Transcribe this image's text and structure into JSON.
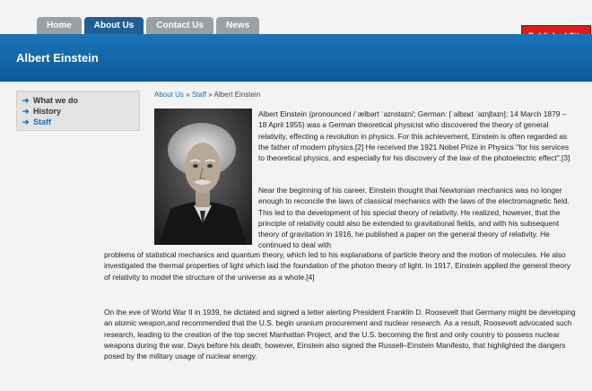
{
  "nav": {
    "tabs": [
      {
        "label": "Home"
      },
      {
        "label": "About Us"
      },
      {
        "label": "Contact Us"
      },
      {
        "label": "News"
      }
    ],
    "published_label": "Published Site"
  },
  "header": {
    "title": "Albert Einstein"
  },
  "sidebar": {
    "items": [
      {
        "label": "What we do"
      },
      {
        "label": "History"
      },
      {
        "label": "Staff"
      }
    ]
  },
  "breadcrumb": {
    "item1": "About Us",
    "sep": " » ",
    "item2": "Staff",
    "current": "Albert Einstein"
  },
  "article": {
    "p1": "Albert Einstein (pronounced /ˈælbərt ˈaɪnstaɪn/; German: [ˈalbɛʁt ˈaɪnʃtaɪn]; 14 March 1879 – 18 April 1955) was a German theoretical physicist who discovered the theory of general relativity, effecting a revolution in physics. For this achievement, Einstein is often regarded as the father of modern physics.[2] He received the 1921 Nobel Prize in Physics \"for his services to theoretical physics, and especially for his discovery of the law of the photoelectric effect\".[3]",
    "p2a": "Near the beginning of his career, Einstein thought that Newtonian mechanics was no longer enough to reconcile the laws of classical mechanics with the laws of the electromagnetic field. This led to the development of his special theory of relativity. He realized, however, that the principle of relativity could also be extended to gravitational fields, and with his subsequent theory of gravitation in 1916, he published a paper on the general theory of relativity. He continued to deal with",
    "p2b": "problems of statistical mechanics and quantum theory, which led to his explanations of particle theory and the motion of molecules. He also investigated the thermal properties of light which laid the foundation of the photon theory of light. In 1917, Einstein applied the general theory of relativity to model the structure of the universe as a whole.[4]",
    "p3": "On the eve of World War II in 1939, he dictated and signed a letter alerting President Franklin D. Roosevelt that Germany might be developing an atomic weapon,and recommended that the U.S. begin uranium procurement and nuclear research. As a result, Roosevelt advocated such research, leading to the creation of the top secret Manhattan Project, and the U.S. becoming the first and only country to possess nuclear weapons during the war. Days before his death, however, Einstein also signed the Russell–Einstein Manifesto, that highlighted the dangers posed by the military usage of nuclear energy."
  },
  "colors": {
    "header_blue": "#1a74ba",
    "active_tab": "#1f5f95",
    "published_red": "#d91c1c",
    "link_blue": "#1a6fb0"
  }
}
